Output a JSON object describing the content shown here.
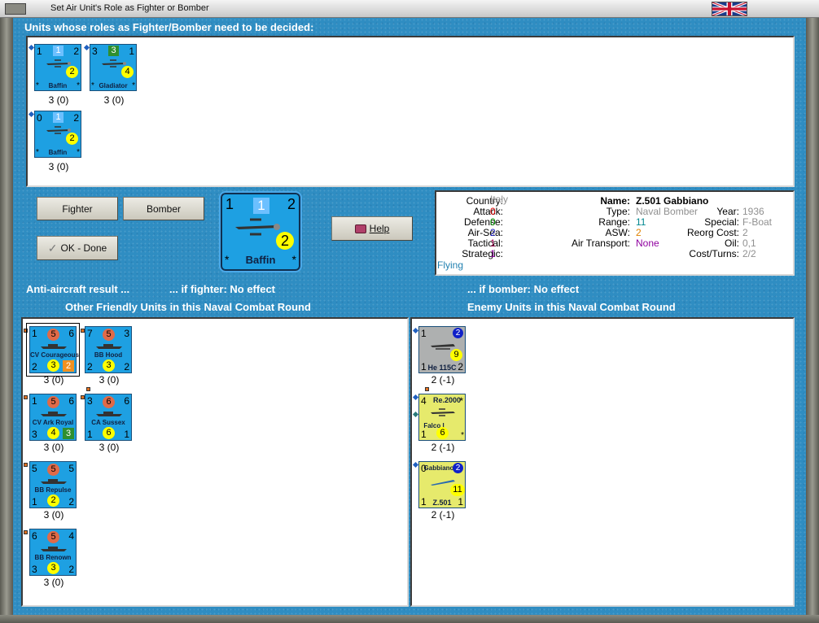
{
  "window": {
    "title": "Set Air Unit's Role as Fighter or Bomber"
  },
  "labels": {
    "undecided": "Units whose roles as Fighter/Bomber need to be decided:",
    "aa_result": "Anti-aircraft result ...",
    "if_fighter": "... if fighter:  No effect",
    "if_bomber": "... if bomber:  No effect",
    "friendly": "Other Friendly Units in this Naval Combat Round",
    "enemy": "Enemy Units in this Naval Combat Round"
  },
  "buttons": {
    "fighter": "Fighter",
    "bomber": "Bomber",
    "ok_done": "OK - Done",
    "help": "Help"
  },
  "undecided_units": [
    {
      "tl": "1",
      "top": "1",
      "tr": "2",
      "mid": "2",
      "name": "Baffin",
      "under": "3 (0)"
    },
    {
      "tl": "3",
      "top": "3",
      "tr": "1",
      "mid": "4",
      "name": "Gladiator",
      "under": "3 (0)"
    },
    {
      "tl": "0",
      "top": "1",
      "tr": "2",
      "mid": "2",
      "name": "Baffin",
      "under": "3 (0)"
    }
  ],
  "selected_unit": {
    "tl": "1",
    "top": "1",
    "tr": "2",
    "mid": "2",
    "name": "Baffin",
    "star": "*"
  },
  "info": {
    "country_k": "Country:",
    "country_v": "Italy",
    "attack_k": "Attack:",
    "attack_v": "0",
    "defense_k": "Defense:",
    "defense_v": "0",
    "airsea_k": "Air-Sea:",
    "airsea_v": "2",
    "tactical_k": "Tactical:",
    "tactical_v": "1",
    "strategic_k": "Strategic:",
    "strategic_v": "1",
    "flying": "Flying",
    "name_k": "Name:",
    "name_v": "Z.501 Gabbiano",
    "type_k": "Type:",
    "type_v": "Naval Bomber",
    "year_k": "Year:",
    "year_v": "1936",
    "range_k": "Range:",
    "range_v": "11",
    "special_k": "Special:",
    "special_v": "F-Boat",
    "asw_k": "ASW:",
    "asw_v": "2",
    "reorg_k": "Reorg Cost:",
    "reorg_v": "2",
    "airtrans_k": "Air Transport:",
    "airtrans_v": "None",
    "oil_k": "Oil:",
    "oil_v": "0,1",
    "cost_k": "Cost/Turns:",
    "cost_v": "2/2",
    "colors": {
      "red": "#e00000",
      "green": "#009000",
      "blue": "#2020c0",
      "purple": "#9000a0",
      "orange": "#e08000",
      "gray": "#909090",
      "teal": "#008890"
    }
  },
  "friendly_units": [
    {
      "tl": "1",
      "circ": "5",
      "tr": "6",
      "name": "CV Courageous",
      "bl": "2",
      "mid": "3",
      "sq": "2",
      "under": "3 (0)"
    },
    {
      "tl": "7",
      "circ": "5",
      "tr": "3",
      "name": "BB Hood",
      "bl": "2",
      "mid": "3",
      "br": "2",
      "under": "3 (0)"
    },
    {
      "tl": "1",
      "circ": "5",
      "tr": "6",
      "name": "CV Ark Royal",
      "bl": "3",
      "mid": "4",
      "sq": "3",
      "under": "3 (0)"
    },
    {
      "tl": "3",
      "circ": "6",
      "tr": "6",
      "name": "CA Sussex",
      "bl": "1",
      "mid": "6",
      "br": "1",
      "under": "3 (0)"
    },
    {
      "tl": "5",
      "circ": "5",
      "tr": "5",
      "name": "BB Repulse",
      "bl": "1",
      "mid": "2",
      "br": "2",
      "under": "3 (0)"
    },
    {
      "tl": "6",
      "circ": "5",
      "tr": "4",
      "name": "BB Renown",
      "bl": "3",
      "mid": "3",
      "br": "2",
      "under": "3 (0)"
    }
  ],
  "enemy_units": [
    {
      "tl": "1",
      "topr": "2",
      "mid": "9",
      "name": "He 115C",
      "bl": "1",
      "br": "2",
      "under": "2 (-1)"
    },
    {
      "tl": "4",
      "title": "Re.2000",
      "sub": "Falco I",
      "bl": "1",
      "mid": "6",
      "under": "2 (-1)"
    },
    {
      "tl": "0",
      "title": "Gabbiano",
      "topr": "2",
      "mid": "11",
      "name": "Z.501",
      "bl": "1",
      "br": "1",
      "under": "2 (-1)"
    }
  ]
}
